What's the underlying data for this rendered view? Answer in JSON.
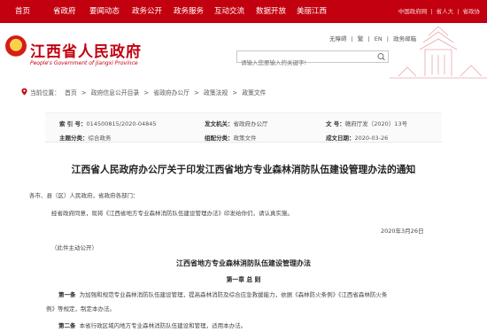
{
  "topnav": {
    "items": [
      "首页",
      "省政府",
      "要闻动态",
      "政务公开",
      "政务服务",
      "互动交流",
      "数据开放",
      "美丽江西"
    ],
    "right": [
      "中国政府网",
      "|",
      "省人大",
      "|",
      "省政协"
    ]
  },
  "header": {
    "title": "江西省人民政府",
    "subtitle": "People's Government of Jiangxi Province",
    "links": [
      "无障碍",
      "|",
      "繁",
      "|",
      "EN",
      "|",
      "政务邮箱"
    ],
    "search_placeholder": "请输入您要输入的关键字!"
  },
  "breadcrumb": {
    "label": "当前位置：",
    "items": [
      "首页",
      ">",
      "政府信息公开目录",
      ">",
      "省政府办公厅",
      ">",
      "政策法规",
      ">",
      "政策文件"
    ]
  },
  "info": {
    "suoyinhao_label": "索 引 号：",
    "suoyinhao_value": "014500815/2020-04845",
    "fawen_label": "发文机关：",
    "fawen_value": "省政府办公厅",
    "wenhao_label": "文    号：",
    "wenhao_value": "赣府厅发〔2020〕13号",
    "zhuti_label": "主题分类：",
    "zhuti_value": "综合政务",
    "zucai_label": "组配分类：",
    "zucai_value": "政策文件",
    "chengwen_label": "成文日期：",
    "chengwen_value": "2020-03-26"
  },
  "article": {
    "title": "江西省人民政府办公厅关于印发江西省地方专业森林消防队伍建设管理办法的通知",
    "salutation": "各市、县（区）人民政府，省政府各部门：",
    "body": "经省政府同意，现将《江西省地方专业森林消防队伍建设管理办法》印发给你们，请认真实施。",
    "date": "2020年3月26日",
    "note": "（此件主动公开）",
    "sub_title": "江西省地方专业森林消防队伍建设管理办法",
    "chapter": "第一章  总  则",
    "art1_lead": "第一条",
    "art1_line1": "为加强和规范专业森林消防队伍建设管理，提高森林消防及综合应急救援能力，依据《森林防火条例》《江西省森林防火条",
    "art1_line2": "例》等规定，制定本办法。",
    "art2_lead": "第二条",
    "art2_text": "本省行政区域内地方专业森林消防队伍建设和管理，适用本办法。"
  }
}
